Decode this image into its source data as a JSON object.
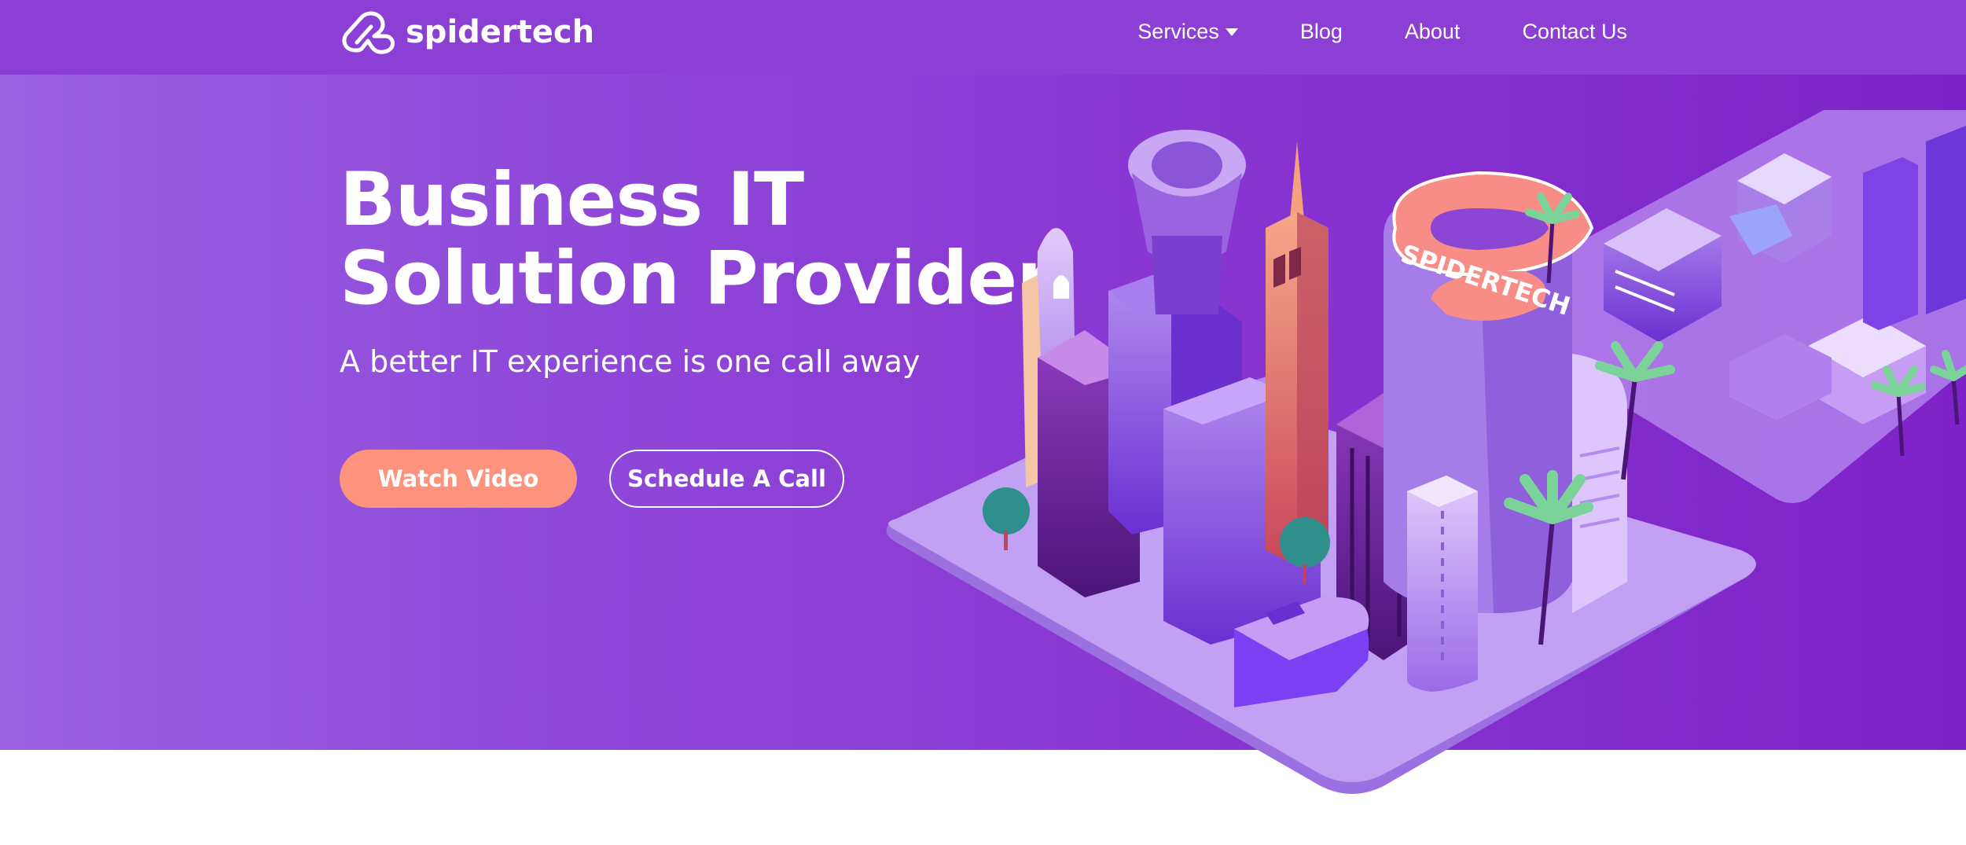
{
  "nav": {
    "logo_text": "spidertech",
    "links": [
      {
        "label": "Services",
        "has_dropdown": true
      },
      {
        "label": "Blog"
      },
      {
        "label": "About"
      },
      {
        "label": "Contact Us"
      }
    ]
  },
  "hero": {
    "title_line1": "Business IT",
    "title_line2": "Solution Provider",
    "subtitle": "A better IT experience is one call away",
    "primary_button": "Watch Video",
    "secondary_button": "Schedule A Call",
    "illustration_sign": "SPIDERTECH"
  },
  "colors": {
    "navbar": "#8b3fd4",
    "hero_left": "#9b62e2",
    "hero_right": "#7d22c8",
    "primary_button": "#fd937c",
    "text": "#ffffff"
  },
  "icons": {
    "logo": "spidertech-logo-icon",
    "dropdown": "caret-down-icon"
  }
}
